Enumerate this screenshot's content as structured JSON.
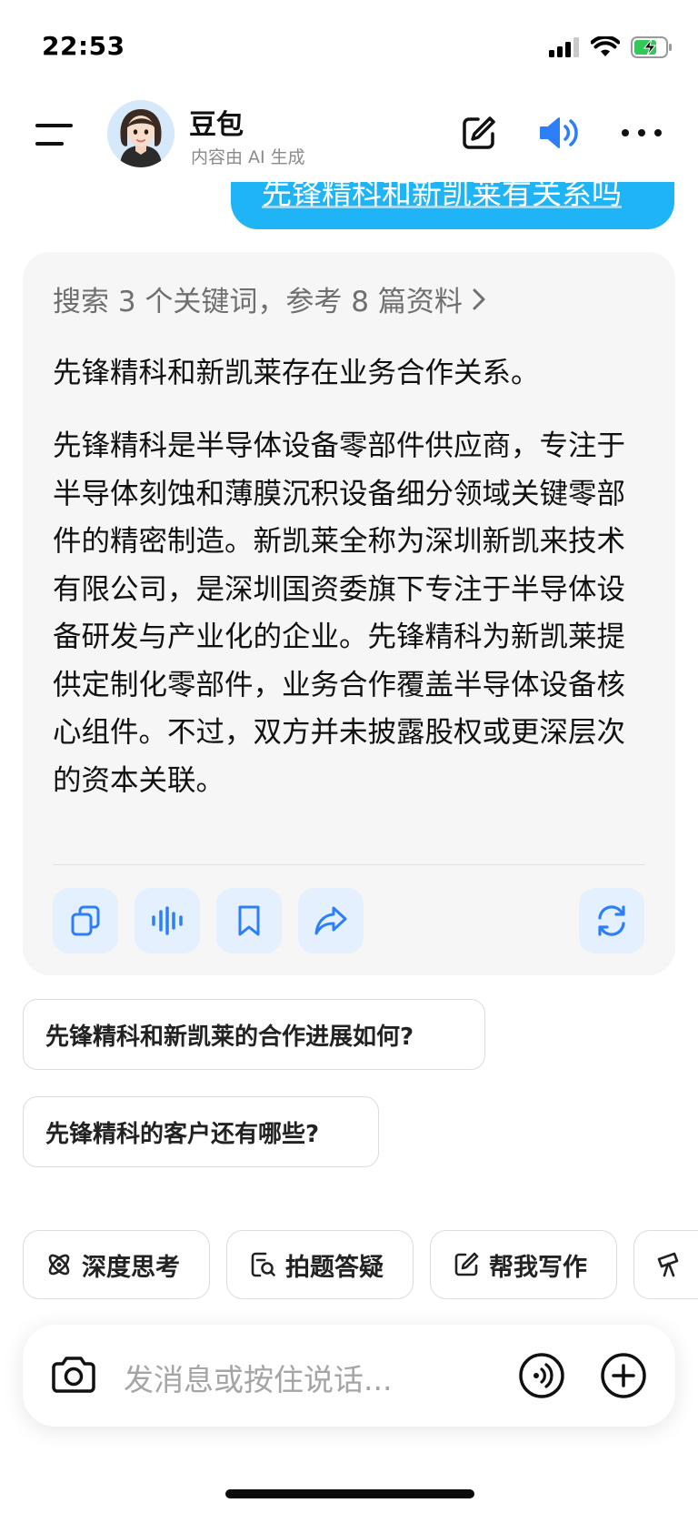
{
  "status_bar": {
    "time": "22:53"
  },
  "header": {
    "bot_name": "豆包",
    "bot_subtitle": "内容由 AI 生成",
    "icons": [
      "menu-icon",
      "edit-icon",
      "speaker-icon",
      "more-icon"
    ]
  },
  "user_message": "先锋精科和新凯莱有关系吗",
  "reply": {
    "search_summary": "搜索 3 个关键词，参考 8 篇资料",
    "paragraph_1": "先锋精科和新凯莱存在业务合作关系。",
    "paragraph_2": "先锋精科是半导体设备零部件供应商，专注于半导体刻蚀和薄膜沉积设备细分领域关键零部件的精密制造。新凯莱全称为深圳新凯来技术有限公司，是深圳国资委旗下专注于半导体设备研发与产业化的企业。先锋精科为新凯莱提供定制化零部件，业务合作覆盖半导体设备核心组件。不过，双方并未披露股权或更深层次的资本关联。",
    "actions": [
      "copy-icon",
      "voice-icon",
      "bookmark-icon",
      "share-icon",
      "regenerate-icon"
    ]
  },
  "suggestions": [
    "先锋精科和新凯莱的合作进展如何?",
    "先锋精科的客户还有哪些?"
  ],
  "chips": [
    {
      "label": "深度思考",
      "icon": "atom-icon"
    },
    {
      "label": "拍题答疑",
      "icon": "scan-question-icon"
    },
    {
      "label": "帮我写作",
      "icon": "write-icon"
    },
    {
      "label": "",
      "icon": "telescope-icon"
    }
  ],
  "input": {
    "placeholder": "发消息或按住说话...",
    "icons": [
      "camera-icon",
      "voice-call-icon",
      "plus-icon"
    ]
  },
  "colors": {
    "accent": "#1fb4f5",
    "action_blue": "#2d7ff9",
    "card_bg": "#f6f6f7",
    "action_bg": "#e5f0fe"
  }
}
